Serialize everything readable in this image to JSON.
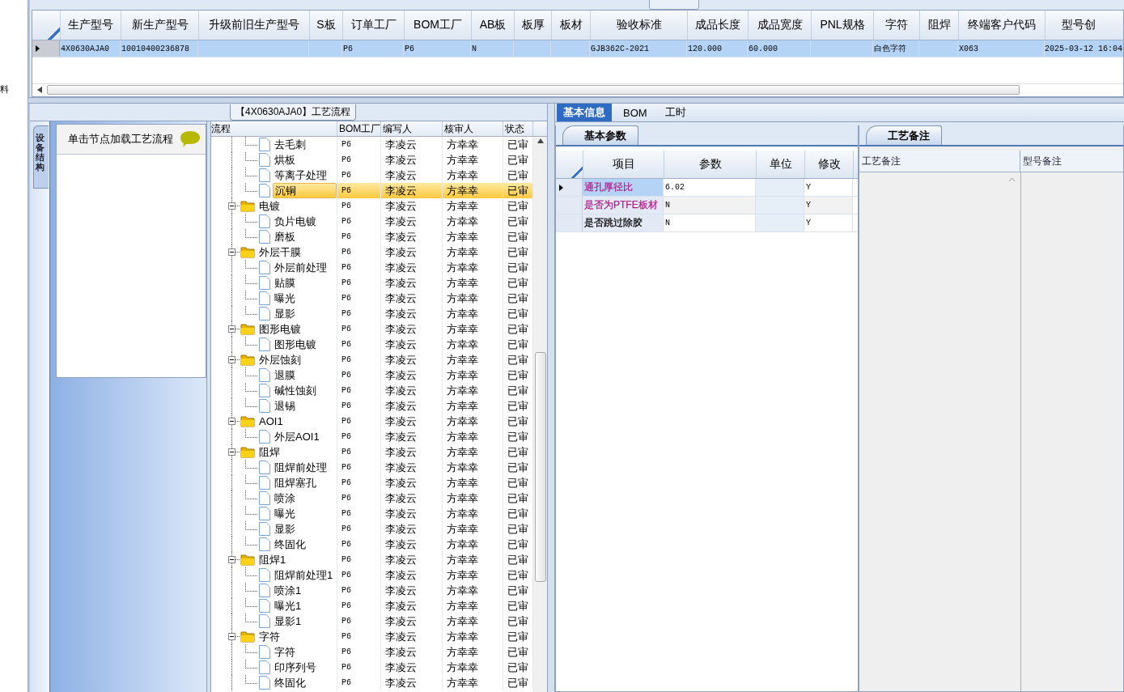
{
  "side_label": "料",
  "main_grid": {
    "columns": [
      "生产型号",
      "新生产型号",
      "升级前旧生产型号",
      "S板",
      "订单工厂",
      "BOM工厂",
      "AB板",
      "板厚",
      "板材",
      "验收标准",
      "成品长度",
      "成品宽度",
      "PNL规格",
      "字符",
      "阻焊",
      "终端客户代码",
      "型号创"
    ],
    "rows": [
      {
        "selected": true,
        "cells": [
          "4X0630AJA0",
          "10010400236878",
          null,
          null,
          "P6",
          "P6",
          "N",
          null,
          null,
          "GJB362C-2021",
          "120.000",
          "60.000",
          null,
          "白色字符",
          null,
          "X063",
          "2025-03-12 16:04"
        ]
      }
    ]
  },
  "process": {
    "title": "【4X0630AJA0】工艺流程",
    "side_tab": "设备结构",
    "hint": "单击节点加载工艺流程",
    "tree": {
      "columns": [
        "流程",
        "BOM工厂",
        "编写人",
        "核审人",
        "状态"
      ],
      "nodes": [
        {
          "kind": "step",
          "label": "去毛刺",
          "bom": "P6",
          "writer": "李凌云",
          "reviewer": "方幸幸",
          "status": "已审",
          "selected": false
        },
        {
          "kind": "step",
          "label": "烘板",
          "bom": "P6",
          "writer": "李凌云",
          "reviewer": "方幸幸",
          "status": "已审",
          "selected": false
        },
        {
          "kind": "step",
          "label": "等离子处理",
          "bom": "P6",
          "writer": "李凌云",
          "reviewer": "方幸幸",
          "status": "已审",
          "selected": false
        },
        {
          "kind": "step",
          "label": "沉铜",
          "bom": "P6",
          "writer": "李凌云",
          "reviewer": "方幸幸",
          "status": "已审",
          "selected": true
        },
        {
          "kind": "folder",
          "label": "电镀",
          "bom": "P6",
          "writer": "李凌云",
          "reviewer": "方幸幸",
          "status": "已审",
          "selected": false,
          "expanded": true,
          "children": [
            {
              "kind": "step",
              "label": "负片电镀",
              "bom": "P6",
              "writer": "李凌云",
              "reviewer": "方幸幸",
              "status": "已审",
              "selected": false
            },
            {
              "kind": "step",
              "label": "磨板",
              "bom": "P6",
              "writer": "李凌云",
              "reviewer": "方幸幸",
              "status": "已审",
              "selected": false
            }
          ]
        },
        {
          "kind": "folder",
          "label": "外层干膜",
          "bom": "P6",
          "writer": "李凌云",
          "reviewer": "方幸幸",
          "status": "已审",
          "selected": false,
          "expanded": true,
          "children": [
            {
              "kind": "step",
              "label": "外层前处理",
              "bom": "P6",
              "writer": "李凌云",
              "reviewer": "方幸幸",
              "status": "已审",
              "selected": false
            },
            {
              "kind": "step",
              "label": "贴膜",
              "bom": "P6",
              "writer": "李凌云",
              "reviewer": "方幸幸",
              "status": "已审",
              "selected": false
            },
            {
              "kind": "step",
              "label": "曝光",
              "bom": "P6",
              "writer": "李凌云",
              "reviewer": "方幸幸",
              "status": "已审",
              "selected": false
            },
            {
              "kind": "step",
              "label": "显影",
              "bom": "P6",
              "writer": "李凌云",
              "reviewer": "方幸幸",
              "status": "已审",
              "selected": false
            }
          ]
        },
        {
          "kind": "folder",
          "label": "图形电镀",
          "bom": "P6",
          "writer": "李凌云",
          "reviewer": "方幸幸",
          "status": "已审",
          "selected": false,
          "expanded": true,
          "children": [
            {
              "kind": "step",
              "label": "图形电镀",
              "bom": "P6",
              "writer": "李凌云",
              "reviewer": "方幸幸",
              "status": "已审",
              "selected": false
            }
          ]
        },
        {
          "kind": "folder",
          "label": "外层蚀刻",
          "bom": "P6",
          "writer": "李凌云",
          "reviewer": "方幸幸",
          "status": "已审",
          "selected": false,
          "expanded": true,
          "children": [
            {
              "kind": "step",
              "label": "退膜",
              "bom": "P6",
              "writer": "李凌云",
              "reviewer": "方幸幸",
              "status": "已审",
              "selected": false
            },
            {
              "kind": "step",
              "label": "碱性蚀刻",
              "bom": "P6",
              "writer": "李凌云",
              "reviewer": "方幸幸",
              "status": "已审",
              "selected": false
            },
            {
              "kind": "step",
              "label": "退锡",
              "bom": "P6",
              "writer": "李凌云",
              "reviewer": "方幸幸",
              "status": "已审",
              "selected": false
            }
          ]
        },
        {
          "kind": "folder",
          "label": "AOI1",
          "bom": "P6",
          "writer": "李凌云",
          "reviewer": "方幸幸",
          "status": "已审",
          "selected": false,
          "expanded": true,
          "children": [
            {
              "kind": "step",
              "label": "外层AOI1",
              "bom": "P6",
              "writer": "李凌云",
              "reviewer": "方幸幸",
              "status": "已审",
              "selected": false
            }
          ]
        },
        {
          "kind": "folder",
          "label": "阻焊",
          "bom": "P6",
          "writer": "李凌云",
          "reviewer": "方幸幸",
          "status": "已审",
          "selected": false,
          "expanded": true,
          "children": [
            {
              "kind": "step",
              "label": "阻焊前处理",
              "bom": "P6",
              "writer": "李凌云",
              "reviewer": "方幸幸",
              "status": "已审",
              "selected": false
            },
            {
              "kind": "step",
              "label": "阻焊塞孔",
              "bom": "P6",
              "writer": "李凌云",
              "reviewer": "方幸幸",
              "status": "已审",
              "selected": false
            },
            {
              "kind": "step",
              "label": "喷涂",
              "bom": "P6",
              "writer": "李凌云",
              "reviewer": "方幸幸",
              "status": "已审",
              "selected": false
            },
            {
              "kind": "step",
              "label": "曝光",
              "bom": "P6",
              "writer": "李凌云",
              "reviewer": "方幸幸",
              "status": "已审",
              "selected": false
            },
            {
              "kind": "step",
              "label": "显影",
              "bom": "P6",
              "writer": "李凌云",
              "reviewer": "方幸幸",
              "status": "已审",
              "selected": false
            },
            {
              "kind": "step",
              "label": "终固化",
              "bom": "P6",
              "writer": "李凌云",
              "reviewer": "方幸幸",
              "status": "已审",
              "selected": false
            }
          ]
        },
        {
          "kind": "folder",
          "label": "阻焊1",
          "bom": "P6",
          "writer": "李凌云",
          "reviewer": "方幸幸",
          "status": "已审",
          "selected": false,
          "expanded": true,
          "children": [
            {
              "kind": "step",
              "label": "阻焊前处理1",
              "bom": "P6",
              "writer": "李凌云",
              "reviewer": "方幸幸",
              "status": "已审",
              "selected": false
            },
            {
              "kind": "step",
              "label": "喷涂1",
              "bom": "P6",
              "writer": "李凌云",
              "reviewer": "方幸幸",
              "status": "已审",
              "selected": false
            },
            {
              "kind": "step",
              "label": "曝光1",
              "bom": "P6",
              "writer": "李凌云",
              "reviewer": "方幸幸",
              "status": "已审",
              "selected": false
            },
            {
              "kind": "step",
              "label": "显影1",
              "bom": "P6",
              "writer": "李凌云",
              "reviewer": "方幸幸",
              "status": "已审",
              "selected": false
            }
          ]
        },
        {
          "kind": "folder",
          "label": "字符",
          "bom": "P6",
          "writer": "李凌云",
          "reviewer": "方幸幸",
          "status": "已审",
          "selected": false,
          "expanded": true,
          "children": [
            {
              "kind": "step",
              "label": "字符",
              "bom": "P6",
              "writer": "李凌云",
              "reviewer": "方幸幸",
              "status": "已审",
              "selected": false
            },
            {
              "kind": "step",
              "label": "印序列号",
              "bom": "P6",
              "writer": "李凌云",
              "reviewer": "方幸幸",
              "status": "已审",
              "selected": false
            },
            {
              "kind": "step",
              "label": "终固化",
              "bom": "P6",
              "writer": "李凌云",
              "reviewer": "方幸幸",
              "status": "已审",
              "selected": false
            }
          ]
        }
      ]
    }
  },
  "detail": {
    "tabs": [
      {
        "label": "基本信息",
        "selected": true
      },
      {
        "label": "BOM",
        "selected": false
      },
      {
        "label": "工时",
        "selected": false
      }
    ],
    "params": {
      "tab": "基本参数",
      "columns": [
        "项目",
        "参数",
        "单位",
        "修改"
      ],
      "rows": [
        {
          "item": "通孔厚径比",
          "value": "6.02",
          "modify": "Y",
          "color": "#b0208c",
          "selected": true
        },
        {
          "item": "是否为PTFE板材",
          "value": "N",
          "modify": "Y",
          "color": "#b0208c",
          "selected": false
        },
        {
          "item": "是否跳过除胶",
          "value": "N",
          "modify": "Y",
          "selected": false
        }
      ]
    },
    "remarks": {
      "tab": "工艺备注",
      "columns": [
        "工艺备注",
        "型号备注"
      ]
    }
  }
}
